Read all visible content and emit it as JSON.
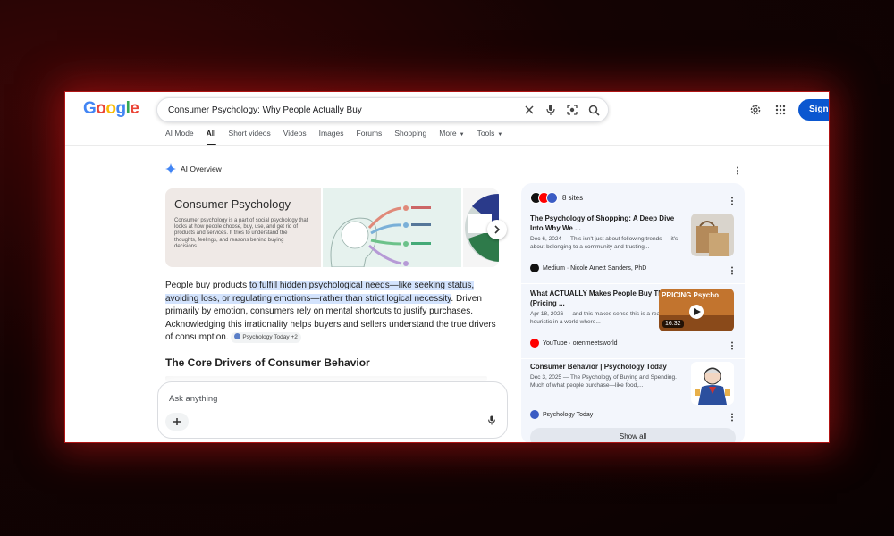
{
  "header": {
    "logo": [
      "G",
      "o",
      "o",
      "g",
      "l",
      "e"
    ],
    "search_value": "Consumer Psychology: Why People Actually Buy",
    "sign_in": "Sign in"
  },
  "tabs": [
    {
      "label": "AI Mode",
      "active": false
    },
    {
      "label": "All",
      "active": true
    },
    {
      "label": "Short videos",
      "active": false
    },
    {
      "label": "Videos",
      "active": false
    },
    {
      "label": "Images",
      "active": false
    },
    {
      "label": "Forums",
      "active": false
    },
    {
      "label": "Shopping",
      "active": false
    },
    {
      "label": "More",
      "active": false,
      "dropdown": true
    },
    {
      "label": "Tools",
      "active": false,
      "dropdown": true
    }
  ],
  "ai_overview": {
    "label": "AI Overview",
    "image1_title": "Consumer Psychology",
    "image1_body": "Consumer psychology is a part of social psychology that looks at how people choose, buy, use, and get rid of products and services. It tries to understand the thoughts, feelings, and reasons behind buying decisions.",
    "text_pre": "People buy products ",
    "text_highlight": "to fulfill hidden psychological needs—like seeking status, avoiding loss, or regulating emotions—rather than strict logical necessity",
    "text_post": ". Driven primarily by emotion, consumers rely on mental shortcuts to justify purchases. Acknowledging this irrationality helps buyers and sellers understand the true drivers of consumption. ",
    "chip": "Psychology Today +2",
    "section_heading": "The Core Drivers of Consumer Behavior"
  },
  "ask": {
    "placeholder": "Ask anything"
  },
  "panel": {
    "sites_label": "8 sites",
    "cards": [
      {
        "title": "The Psychology of Shopping: A Deep Dive Into Why We ...",
        "snippet": "Dec 6, 2024 — This isn't just about following trends — it's about belonging to a community and trusting...",
        "source": "Medium · Nicole Arnett Sanders, PhD"
      },
      {
        "title": "What ACTUALLY Makes People Buy Things (Pricing ...",
        "snippet": "Apr 18, 2026 — and this makes sense this is a reasonable heuristic in a world where...",
        "source": "YouTube · orenmeetsworld",
        "thumb_text": "PRICING Psycho",
        "duration": "16:32"
      },
      {
        "title": "Consumer Behavior | Psychology Today",
        "snippet": "Dec 3, 2025 — The Psychology of Buying and Spending. Much of what people purchase—like food,...",
        "source": "Psychology Today"
      }
    ],
    "show_all": "Show all"
  },
  "colors": {
    "accent_blue": "#0b57d0",
    "highlight": "#d3e3fd",
    "panel_bg": "#f3f6fc"
  }
}
